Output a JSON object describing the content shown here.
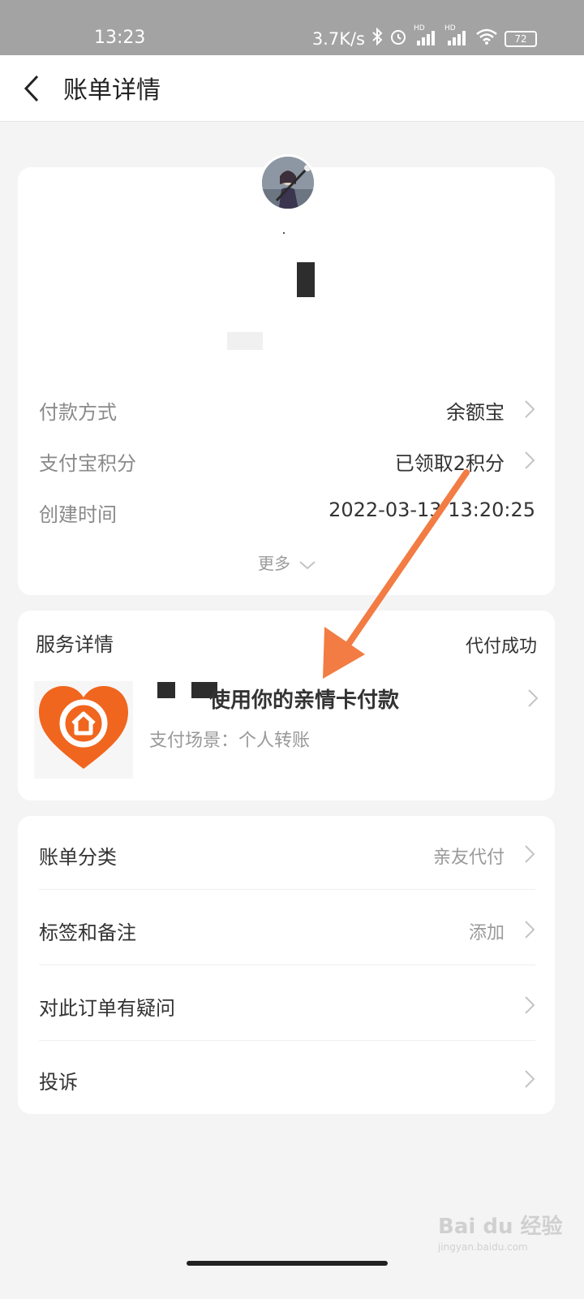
{
  "status_bar": {
    "time": "13:23",
    "net_speed": "3.7K/s",
    "hd1": "HD",
    "hd2": "HD",
    "battery": "72"
  },
  "header": {
    "title": "账单详情"
  },
  "summary": {
    "rows": [
      {
        "label": "付款方式",
        "value": "余额宝"
      },
      {
        "label": "支付宝积分",
        "value": "已领取2积分"
      },
      {
        "label": "创建时间",
        "value": "2022-03-13 13:20:25"
      }
    ],
    "more_label": "更多"
  },
  "service": {
    "title": "服务详情",
    "status": "代付成功",
    "name": "使用你的亲情卡付款",
    "scene": "支付场景：个人转账",
    "logo_color": "#f0661e"
  },
  "list": [
    {
      "label": "账单分类",
      "value": "亲友代付"
    },
    {
      "label": "标签和备注",
      "value": "添加"
    },
    {
      "label": "对此订单有疑问",
      "value": ""
    },
    {
      "label": "投诉",
      "value": ""
    }
  ],
  "annotation_color": "#f27c43",
  "watermark": {
    "main": "Bai du 经验",
    "url": "jingyan.baidu.com"
  }
}
